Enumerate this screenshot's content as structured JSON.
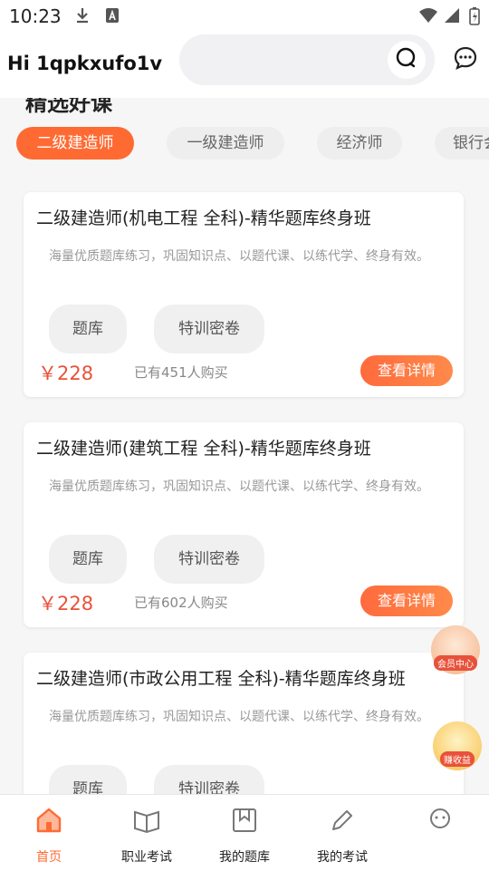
{
  "status_bar": {
    "time": "10:23"
  },
  "header": {
    "greeting": "Hi 1qpkxufo1v"
  },
  "section": {
    "title": "精选好课"
  },
  "tabs": [
    {
      "label": "二级建造师",
      "active": true
    },
    {
      "label": "一级建造师",
      "active": false
    },
    {
      "label": "经济师",
      "active": false
    },
    {
      "label": "银行会",
      "active": false
    }
  ],
  "courses": [
    {
      "title": "二级建造师(机电工程 全科)-精华题库终身班",
      "desc": "海量优质题库练习，巩固知识点、以题代课、以练代学、终身有效。",
      "chip1": "题库",
      "chip2": "特训密卷",
      "price": "￥228",
      "sold": "已有451人购买",
      "cta": "查看详情"
    },
    {
      "title": "二级建造师(建筑工程 全科)-精华题库终身班",
      "desc": "海量优质题库练习，巩固知识点、以题代课、以练代学、终身有效。",
      "chip1": "题库",
      "chip2": "特训密卷",
      "price": "￥228",
      "sold": "已有602人购买",
      "cta": "查看详情"
    },
    {
      "title": "二级建造师(市政公用工程 全科)-精华题库终身班",
      "desc": "海量优质题库练习，巩固知识点、以题代课、以练代学、终身有效。",
      "chip1": "题库",
      "chip2": "特训密卷"
    }
  ],
  "floating": {
    "member_label": "会员中心",
    "earn_label": "赚收益"
  },
  "bottom_nav": [
    {
      "label": "首页",
      "icon": "home-icon",
      "active": true
    },
    {
      "label": "职业考试",
      "icon": "book-icon",
      "active": false
    },
    {
      "label": "我的题库",
      "icon": "bookmark-icon",
      "active": false
    },
    {
      "label": "我的考试",
      "icon": "pencil-icon",
      "active": false
    },
    {
      "label": "",
      "icon": "profile-icon",
      "active": false
    }
  ],
  "colors": {
    "accent": "#ff6a33",
    "price": "#e8523a"
  }
}
